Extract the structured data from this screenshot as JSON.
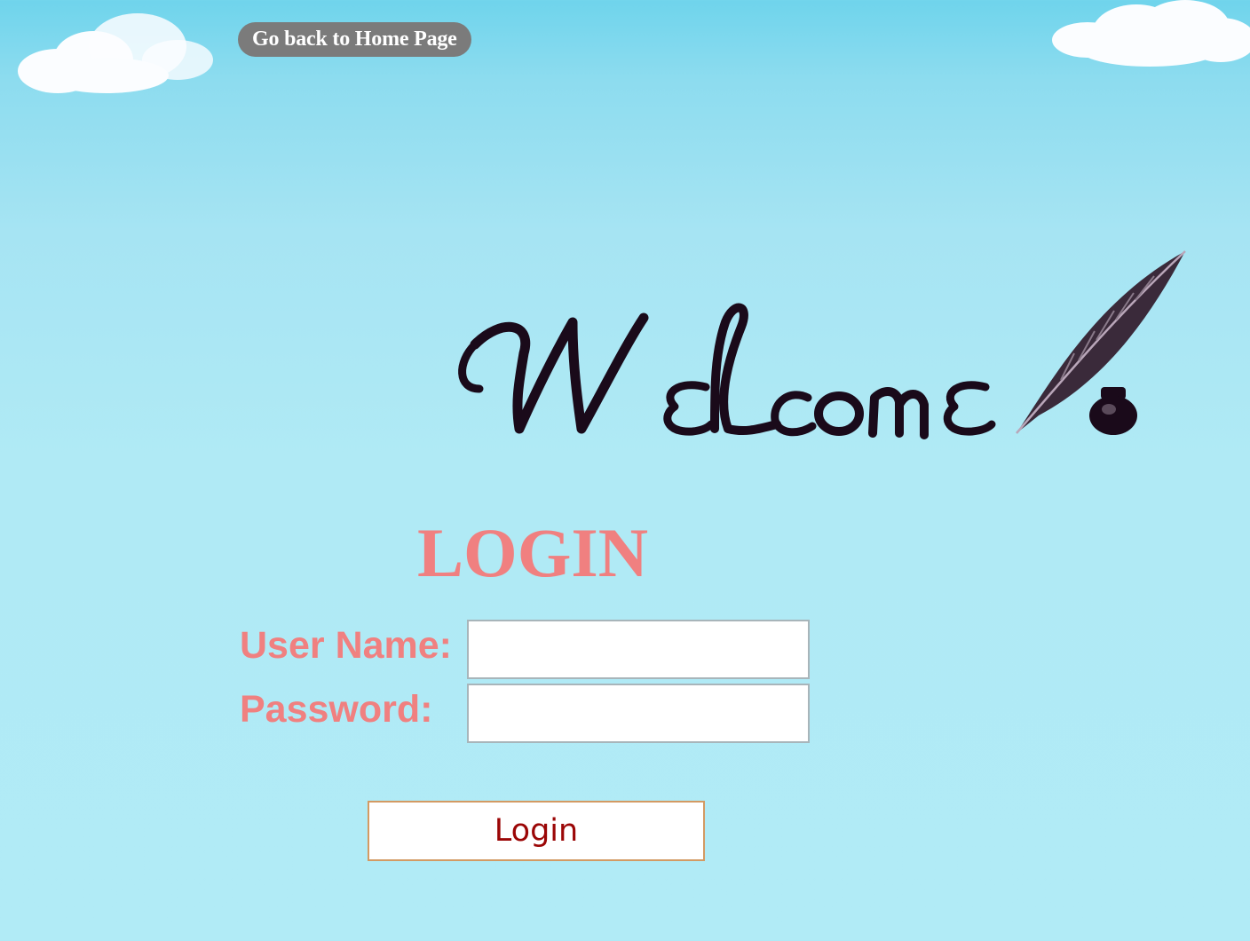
{
  "nav": {
    "home_link_label": "Go back to Home Page"
  },
  "logo": {
    "text": "Welcome",
    "icon": "quill-pen-and-inkwell-icon"
  },
  "login_form": {
    "title": "LOGIN",
    "username_label": "User Name:",
    "username_value": "",
    "password_label": "Password:",
    "password_value": "",
    "submit_label": "Login"
  },
  "colors": {
    "accent_text": "#f08080",
    "button_text": "#9b0606",
    "home_button_bg": "#7b7b7b",
    "sky": "#b0eaf5"
  }
}
